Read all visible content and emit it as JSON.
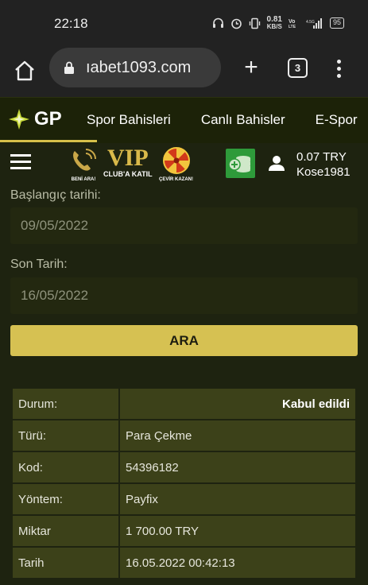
{
  "status_bar": {
    "time": "22:18",
    "net_speed_top": "0.81",
    "net_speed_unit": "KB/S",
    "battery": "95",
    "icons": [
      "headphones-icon",
      "alarm-icon",
      "vibrate-icon",
      "volte-icon",
      "signal-icon",
      "battery-icon"
    ]
  },
  "browser": {
    "url": "ıabet1093.com",
    "tab_count": "3"
  },
  "site_nav": {
    "logo_text": "GP",
    "links": [
      "Spor Bahisleri",
      "Canlı Bahisler",
      "E-Spor"
    ]
  },
  "sub_header": {
    "promo_call_caption": "BENİ ARA!",
    "promo_vip_text": "VIP",
    "promo_vip_caption": "CLUB'A KATIL",
    "promo_wheel_caption": "ÇEVİR KAZAN!",
    "balance": "0.07 TRY",
    "username": "Kose1981"
  },
  "form": {
    "start_label": "Başlangıç tarihi:",
    "start_value": "09/05/2022",
    "end_label": "Son Tarih:",
    "end_value": "16/05/2022",
    "search_button": "ARA"
  },
  "details": [
    {
      "key": "Durum:",
      "value": "Kabul edildi"
    },
    {
      "key": "Türü:",
      "value": "Para Çekme"
    },
    {
      "key": "Kod:",
      "value": "54396182"
    },
    {
      "key": "Yöntem:",
      "value": "Payfix"
    },
    {
      "key": "Miktar",
      "value": "1 700.00 TRY"
    },
    {
      "key": "Tarih",
      "value": "16.05.2022 00:42:13"
    }
  ],
  "colors": {
    "accent": "#d6c152",
    "background": "#1e2310",
    "table_cell": "#3c4119",
    "cashier_green": "#2e9a3a"
  }
}
